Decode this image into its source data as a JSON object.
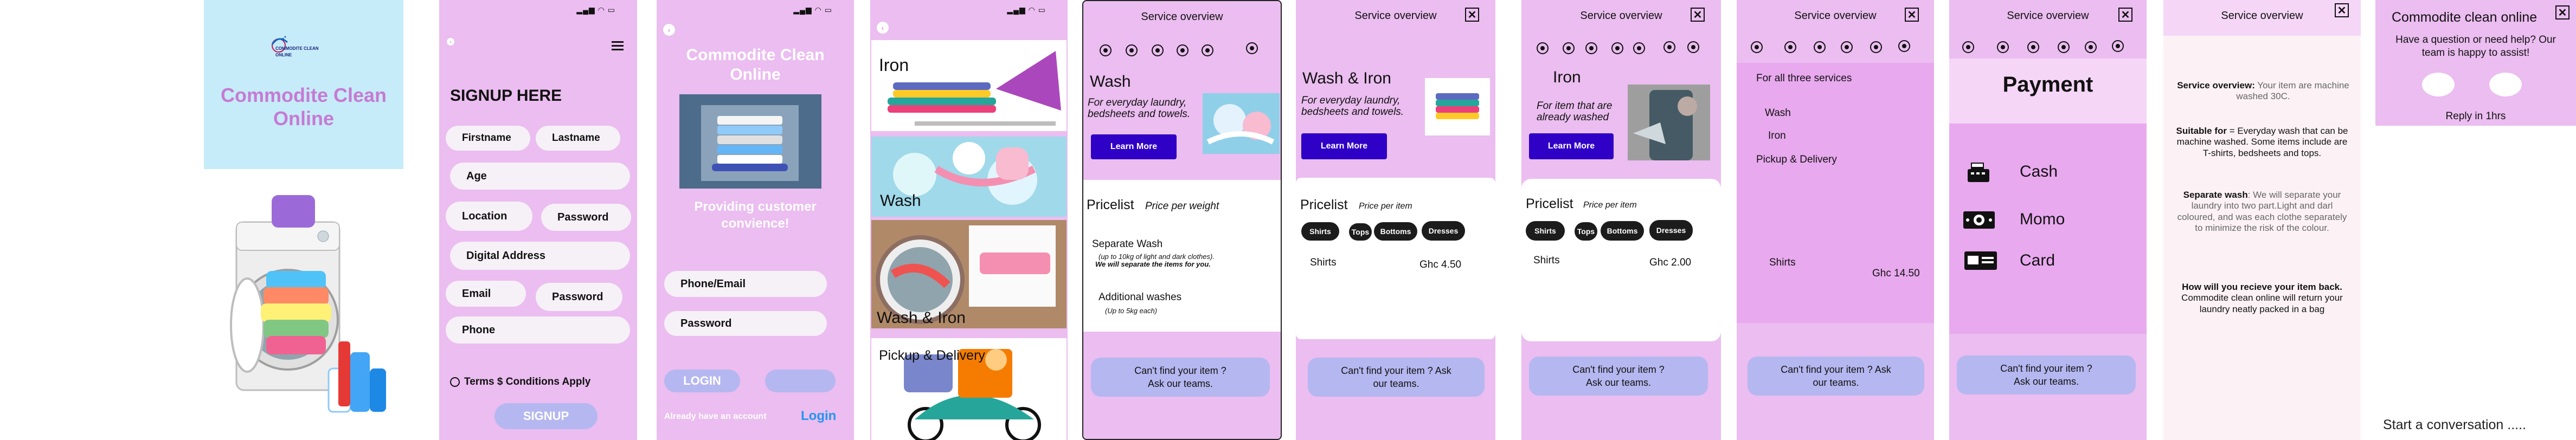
{
  "colors": {
    "pink": "#ebbdf0",
    "lightblue": "#c6ecfa",
    "purple": "#2f00c5",
    "ask": "#b5b7f0",
    "brand": "#c67ad3"
  },
  "splash": {
    "logo_text": "COMMODITE CLEAN ONLINE",
    "title": "Commodite Clean Online"
  },
  "signup": {
    "heading": "SIGNUP HERE",
    "fields": [
      "Firstname",
      "Lastname",
      "Age",
      "Location",
      "Password",
      "Digital Address",
      "Email",
      "Password",
      "Phone"
    ],
    "terms": "Terms $ Conditions Apply",
    "button": "SIGNUP"
  },
  "login": {
    "title": "Commodite Clean Online",
    "tagline": "Providing customer convience!",
    "phone_field": "Phone/Email",
    "password_field": "Password",
    "login_button": "LOGIN",
    "account_text": "Already have an account",
    "login_link": "Login"
  },
  "services": {
    "items": [
      "Iron",
      "Wash",
      "Wash & Iron",
      "Pickup & Delivery"
    ]
  },
  "wash": {
    "header": "Service overview",
    "name": "Wash",
    "desc": "For everyday laundry, bedsheets and towels.",
    "learn": "Learn More",
    "pricelist": "Pricelist",
    "price_note": "Price per weight",
    "separate": "Separate Wash",
    "separate_sub": "(up to 10kg of light and dark clothes).",
    "separate_note": "We will separate the items for you.",
    "additional": "Additional washes",
    "additional_sub": "(Up to 5kg each)",
    "ask": "Can't find your item ? Ask our teams."
  },
  "washiron": {
    "header": "Service overview",
    "name": "Wash & Iron",
    "desc": "For everyday laundry, bedsheets and towels.",
    "learn": "Learn More",
    "pricelist": "Pricelist",
    "price_note": "Price per item",
    "chips": [
      "Shirts",
      "Tops",
      "Bottoms",
      "Dresses"
    ],
    "item": "Shirts",
    "price": "Ghc 4.50",
    "ask": "Can't find your item ? Ask our teams."
  },
  "iron": {
    "header": "Service overview",
    "name": "Iron",
    "desc": "For item that are already washed",
    "learn": "Learn More",
    "pricelist": "Pricelist",
    "price_note": "Price per item",
    "chips": [
      "Shirts",
      "Tops",
      "Bottoms",
      "Dresses"
    ],
    "item": "Shirts",
    "price": "Ghc 2.00",
    "ask": "Can't find your item ? Ask our teams."
  },
  "allthree": {
    "header": "Service overview",
    "heading": "For all three services",
    "items": [
      "Wash",
      "Iron",
      "Pickup & Delivery"
    ],
    "item": "Shirts",
    "price": "Ghc 14.50",
    "ask": "Can't find your item ? Ask our teams."
  },
  "payment": {
    "header": "Service overview",
    "title": "Payment",
    "options": [
      "Cash",
      "Momo",
      "Card"
    ],
    "ask": "Can't find your item ? Ask our teams."
  },
  "overview": {
    "header": "Service overview",
    "p1_label": "Service overview:",
    "p1": "Your item are machine washed 30C.",
    "p2_label": "Suitable for",
    "p2": "= Everyday wash that can be machine washed. Some items include are T-shirts, bedsheets and tops.",
    "p3_label": "Separate wash",
    "p3": ": We will separate your laundry into two part.Light and darl coloured, and was each clothe separately to minimize the risk of the colour.",
    "p4_label": "How will you recieve your item back.",
    "p4": "Commodite clean online will return your laundry neatly packed in a bag"
  },
  "chat": {
    "title": "Commodite clean online",
    "question": "Have a question or need help? Our team is happy to assist!",
    "reply": "Reply in 1hrs",
    "start": "Start a conversation ....."
  }
}
